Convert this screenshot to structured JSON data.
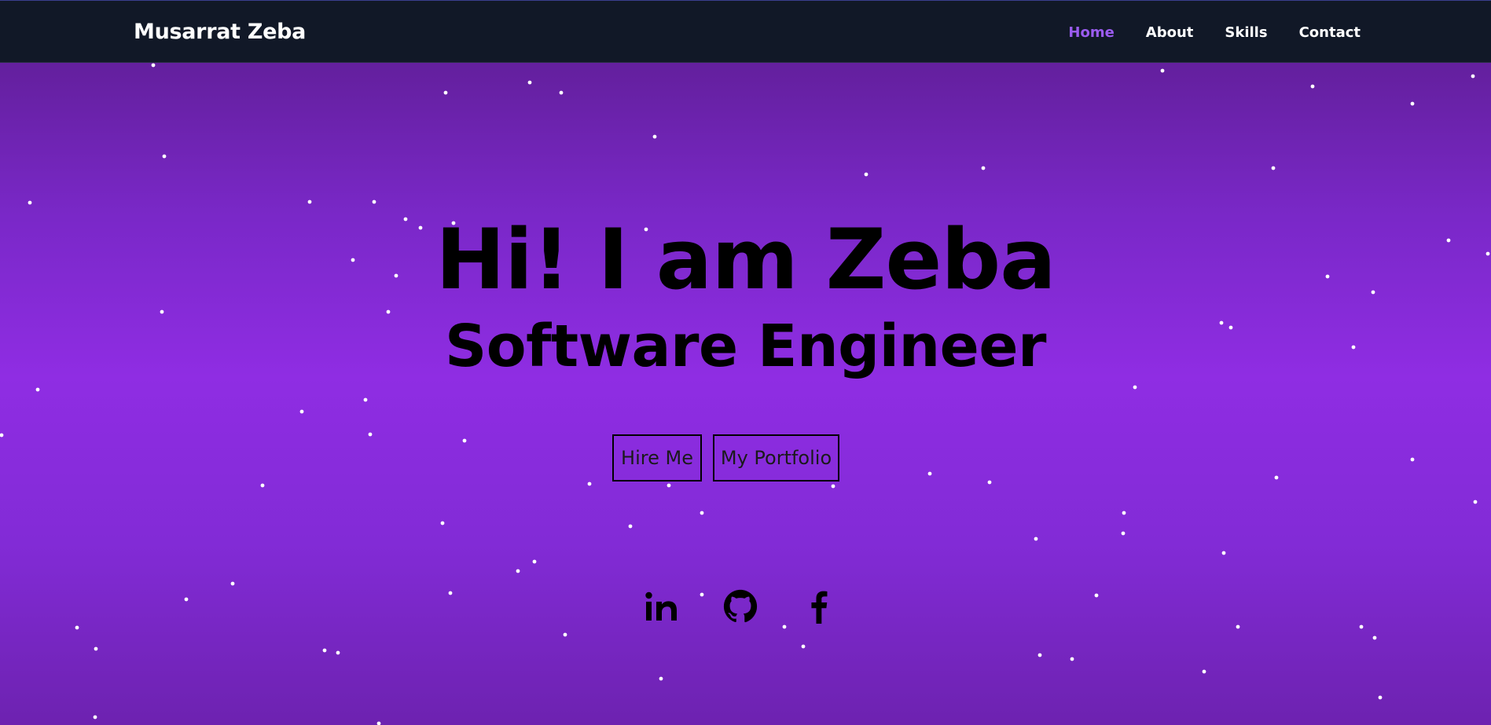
{
  "navbar": {
    "brand": "Musarrat Zeba",
    "links": [
      {
        "label": "Home",
        "active": true
      },
      {
        "label": "About",
        "active": false
      },
      {
        "label": "Skills",
        "active": false
      },
      {
        "label": "Contact",
        "active": false
      }
    ]
  },
  "hero": {
    "title": "Hi! I am Zeba",
    "subtitle": "Software Engineer",
    "buttons": {
      "hire": "Hire Me",
      "portfolio": "My Portfolio"
    }
  },
  "social": [
    {
      "name": "linkedin",
      "icon": "linkedin-icon"
    },
    {
      "name": "github",
      "icon": "github-icon"
    },
    {
      "name": "facebook",
      "icon": "facebook-icon"
    }
  ],
  "colors": {
    "navbar_bg": "#111827",
    "accent_active": "#9b5cf0",
    "hero_gradient_top": "#5a1c8c",
    "hero_gradient_mid": "#8f2de3",
    "star": "#ffffff"
  }
}
